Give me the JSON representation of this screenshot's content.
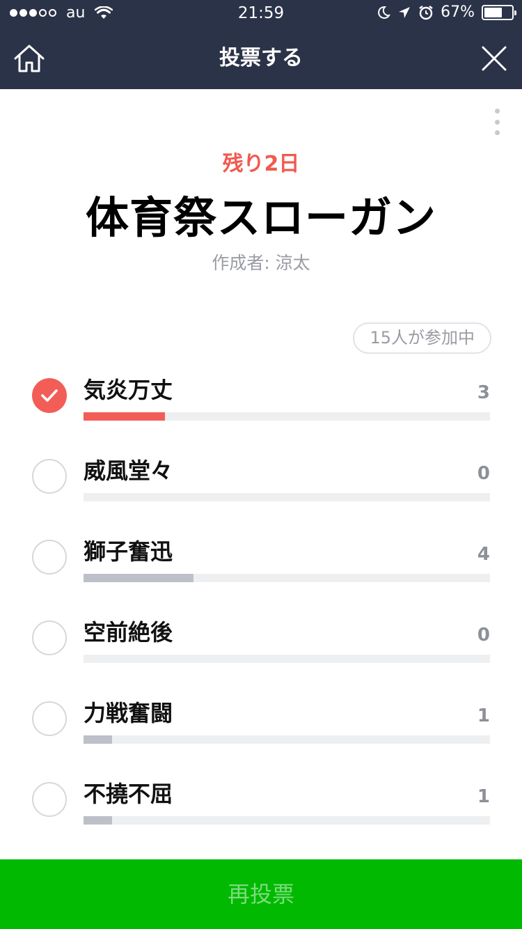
{
  "status_bar": {
    "carrier": "au",
    "time": "21:59",
    "battery": "67%",
    "battery_level": 0.67
  },
  "header": {
    "title": "投票する"
  },
  "poll": {
    "remaining": "残り2日",
    "title": "体育祭スローガン",
    "creator": "作成者: 涼太",
    "participants": "15人が参加中",
    "options": [
      {
        "label": "気炎万丈",
        "count": "3",
        "selected": true,
        "share": 0.2
      },
      {
        "label": "威風堂々",
        "count": "0",
        "selected": false,
        "share": 0
      },
      {
        "label": "獅子奮迅",
        "count": "4",
        "selected": false,
        "share": 0.27
      },
      {
        "label": "空前絶後",
        "count": "0",
        "selected": false,
        "share": 0
      },
      {
        "label": "力戦奮闘",
        "count": "1",
        "selected": false,
        "share": 0.07
      },
      {
        "label": "不撓不屈",
        "count": "1",
        "selected": false,
        "share": 0.07
      }
    ]
  },
  "footer": {
    "revote_label": "再投票"
  },
  "colors": {
    "header_bg": "#2b3348",
    "accent_red": "#f25e57",
    "line_green": "#00b900",
    "bar_gray": "#bdc0c8"
  }
}
